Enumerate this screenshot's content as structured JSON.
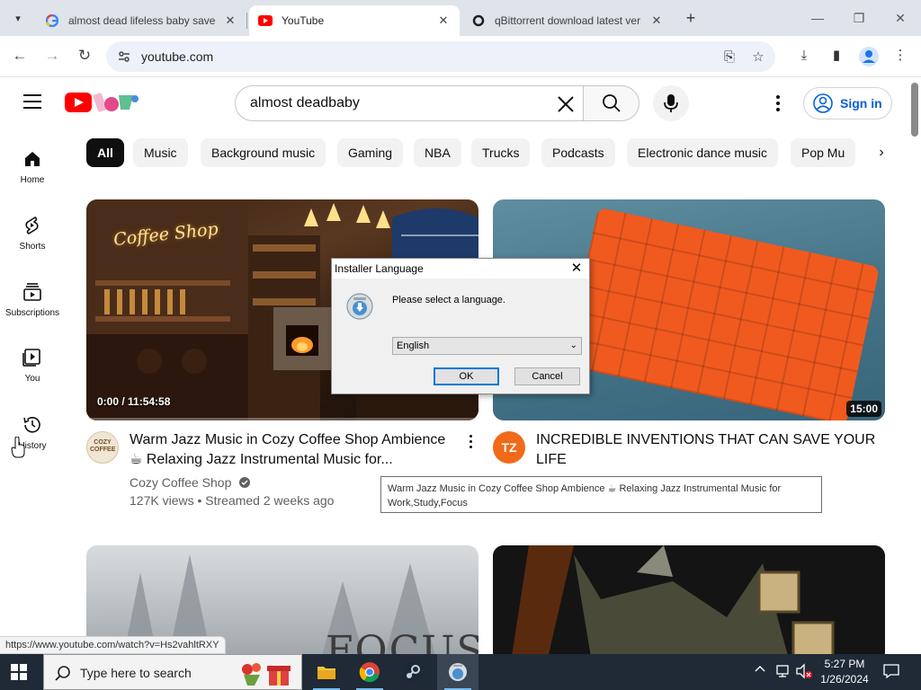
{
  "browser": {
    "tabs": [
      {
        "title": "almost dead lifeless baby save",
        "favicon": "google-icon"
      },
      {
        "title": "YouTube",
        "favicon": "youtube-icon",
        "active": true
      },
      {
        "title": "qBittorrent download latest ver",
        "favicon": "search-icon"
      }
    ],
    "url": "youtube.com",
    "status_url": "https://www.youtube.com/watch?v=Hs2vahltRXY"
  },
  "youtube": {
    "search_query": "almost deadbaby",
    "sign_in": "Sign in",
    "guide": [
      "Home",
      "Shorts",
      "Subscriptions",
      "You",
      "History"
    ],
    "chips": [
      "All",
      "Music",
      "Background music",
      "Gaming",
      "NBA",
      "Trucks",
      "Podcasts",
      "Electronic dance music",
      "Pop Mu"
    ],
    "videos": [
      {
        "title_line1": "Warm Jazz Music in Cozy Coffee Shop Ambience",
        "title_line2": "☕ Relaxing Jazz Instrumental Music for...",
        "channel": "Cozy Coffee Shop",
        "meta": "127K views • Streamed 2 weeks ago",
        "overlay_time": "0:00 / 11:54:58",
        "thumb_text": "Coffee Shop",
        "avatar_text": "COZY COFFEE"
      },
      {
        "title_line1": "INCREDIBLE INVENTIONS THAT CAN SAVE YOUR",
        "title_line2": "LIFE",
        "duration": "15:00",
        "avatar_text": "TZ"
      },
      {
        "thumb_text": "FOCUS"
      },
      {
        "thumb_text": ""
      }
    ],
    "tooltip": "Warm Jazz Music in Cozy Coffee Shop Ambience ☕ Relaxing Jazz Instrumental Music for Work,Study,Focus"
  },
  "dialog": {
    "title": "Installer Language",
    "message": "Please select a language.",
    "selected_language": "English",
    "ok": "OK",
    "cancel": "Cancel"
  },
  "taskbar": {
    "search_placeholder": "Type here to search",
    "time": "5:27 PM",
    "date": "1/26/2024"
  },
  "colors": {
    "youtube_red": "#ff0000",
    "link_blue": "#065fd4",
    "dialog_default_border": "#0078d7",
    "taskbar": "#1f2a36"
  }
}
